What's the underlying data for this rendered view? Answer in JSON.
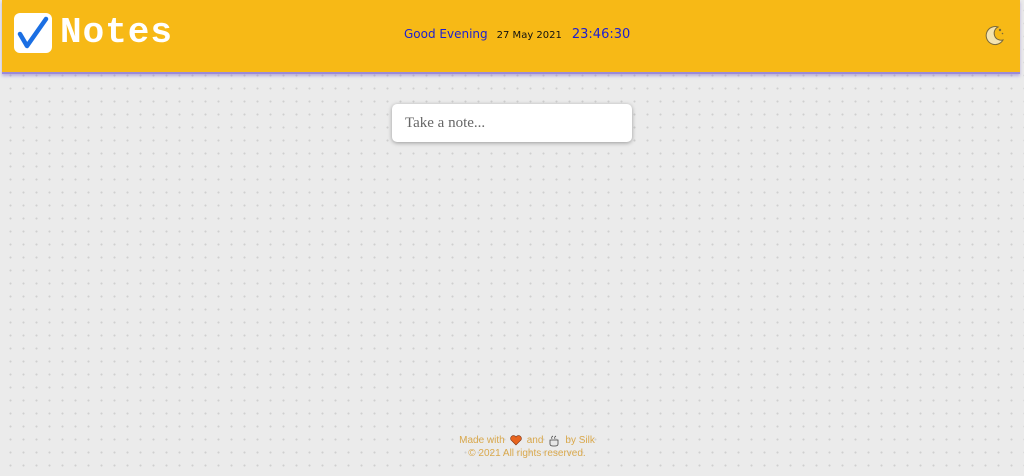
{
  "app": {
    "title": "Notes",
    "icons": {
      "logo": "checkmark-icon",
      "theme": "moon-icon"
    }
  },
  "header": {
    "greeting": "Good Evening",
    "date": "27 May 2021",
    "time": "23:46:30"
  },
  "note_input": {
    "placeholder": "Take a note..."
  },
  "footer": {
    "made_with": "Made with",
    "and": "and",
    "by": "by Silk",
    "copyright": "© 2021 All rights reserved.",
    "icons": [
      "heart-icon",
      "coffee-icon"
    ]
  },
  "colors": {
    "header_bg": "#f7b916",
    "header_border": "#9b8ad8",
    "greeting_time": "#1d1fd0",
    "footer_text": "#d9a84c",
    "page_bg": "#ebebeb"
  }
}
